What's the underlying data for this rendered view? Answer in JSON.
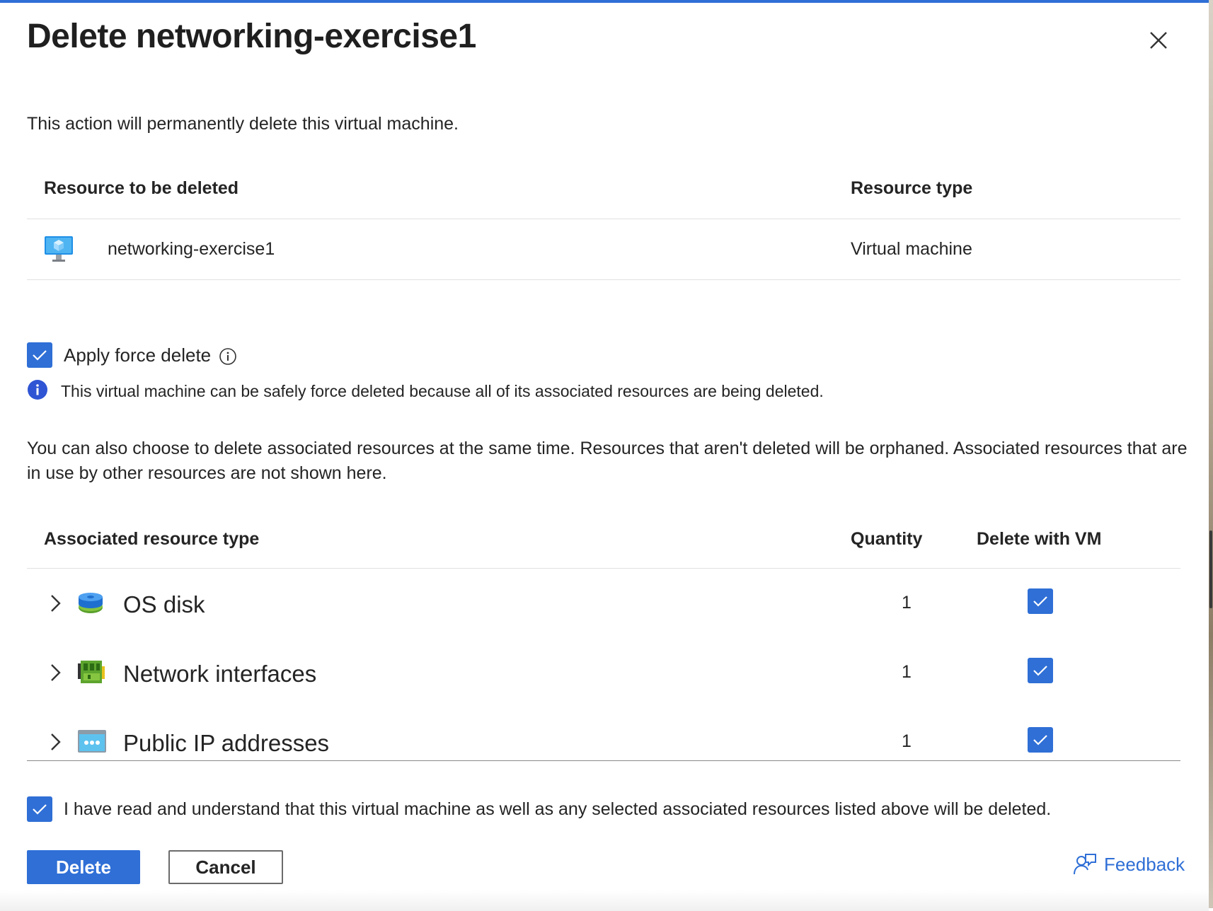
{
  "dialog": {
    "title": "Delete networking-exercise1",
    "description": "This action will permanently delete this virtual machine."
  },
  "resource_table": {
    "headers": [
      "Resource to be deleted",
      "Resource type"
    ],
    "row": {
      "name": "networking-exercise1",
      "type": "Virtual machine",
      "icon": "virtual-machine-icon"
    }
  },
  "force_delete": {
    "label": "Apply force delete",
    "checked": true,
    "info": "This virtual machine can be safely force deleted because all of its associated resources are being deleted."
  },
  "associated_paragraph": "You can also choose to delete associated resources at the same time. Resources that aren't deleted will be orphaned. Associated resources that are in use by other resources are not shown here.",
  "associated_table": {
    "headers": [
      "Associated resource type",
      "Quantity",
      "Delete with VM"
    ],
    "rows": [
      {
        "name": "OS disk",
        "quantity": "1",
        "checked": true,
        "icon": "disk-icon"
      },
      {
        "name": "Network interfaces",
        "quantity": "1",
        "checked": true,
        "icon": "network-interface-icon"
      },
      {
        "name": "Public IP addresses",
        "quantity": "1",
        "checked": true,
        "icon": "public-ip-icon"
      }
    ]
  },
  "confirm": {
    "label": "I have read and understand that this virtual machine as well as any selected associated resources listed above will be deleted.",
    "checked": true
  },
  "buttons": {
    "delete": "Delete",
    "cancel": "Cancel",
    "feedback": "Feedback"
  },
  "colors": {
    "accent": "#2f6fd6",
    "text": "#242424"
  }
}
